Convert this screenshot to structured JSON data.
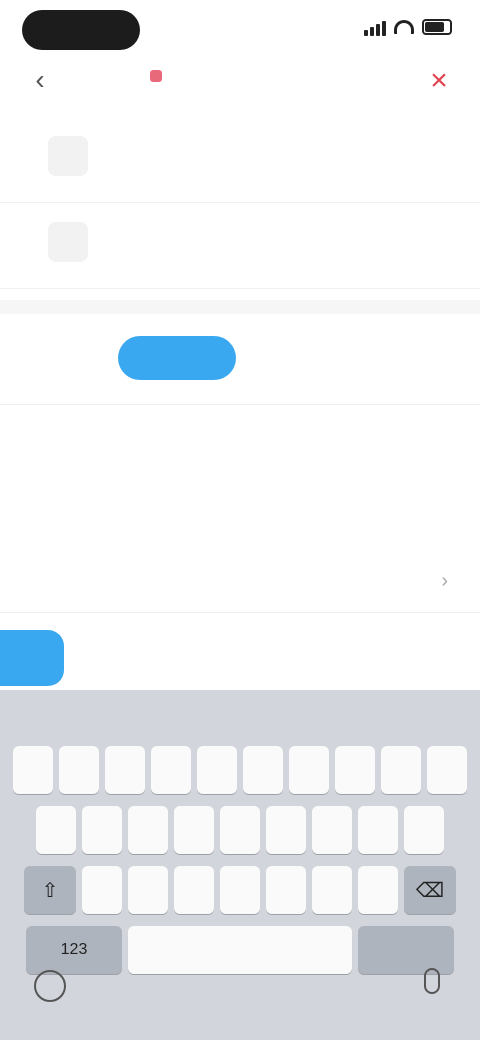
{
  "status": {
    "time": ""
  },
  "header": {
    "title": "",
    "subtitle": ""
  },
  "addresses": [
    {
      "title": "",
      "sub": ""
    },
    {
      "title": "",
      "sub": ""
    }
  ],
  "tabs": [
    {
      "label": ""
    },
    {
      "label": ""
    }
  ],
  "route": {
    "option_a": "",
    "option_b": "",
    "detail_title": "",
    "detail_sub": "",
    "extra": ""
  },
  "go_label": "",
  "modes": [
    "",
    "",
    ""
  ],
  "keyboard": {
    "suggestions": [
      "",
      "",
      ""
    ],
    "row1": [
      "",
      "",
      "",
      "",
      "",
      "",
      "",
      "",
      "",
      ""
    ],
    "row2": [
      "",
      "",
      "",
      "",
      "",
      "",
      "",
      "",
      ""
    ],
    "row3": [
      "",
      "",
      "",
      "",
      "",
      "",
      ""
    ],
    "space_label": "",
    "return_label": ""
  },
  "colors": {
    "accent": "#3aa8f0",
    "close": "#e2424e",
    "keyboard_bg": "#d2d5db"
  }
}
